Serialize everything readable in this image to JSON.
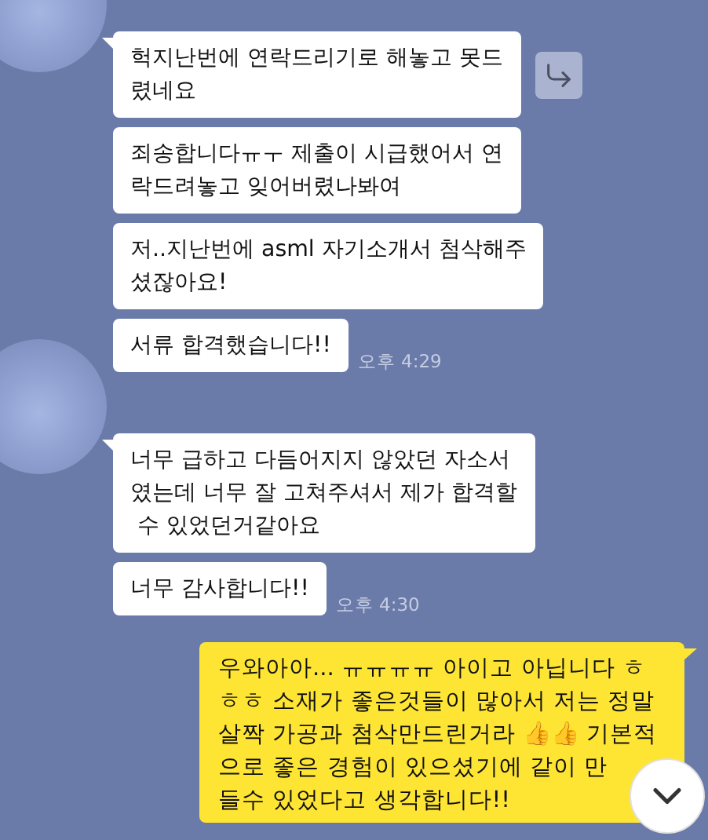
{
  "groups": [
    {
      "kind": "received",
      "time": "오후 4:29",
      "messages": [
        {
          "text": "헉지난번에 연락드리기로 해놓고 못드\n렸네요",
          "forward_button": true
        },
        {
          "text": "죄송합니다ㅠㅜ 제출이 시급했어서 연\n락드려놓고 잊어버렸나봐여"
        },
        {
          "text": "저..지난번에 asml 자기소개서 첨삭해주\n셨잖아요!"
        },
        {
          "text": "서류 합격했습니다!!"
        }
      ]
    },
    {
      "kind": "received",
      "time": "오후 4:30",
      "messages": [
        {
          "text": "너무 급하고 다듬어지지 않았던 자소서\n였는데 너무 잘 고쳐주셔서 제가 합격할\n 수 있었던거같아요"
        },
        {
          "text": "너무 감사합니다!!"
        }
      ]
    },
    {
      "kind": "sent",
      "messages": [
        {
          "text": "우와아아... ㅠㅠㅠㅠ 아이고 아닙니다 ㅎㅎㅎ 소재가 좋은것들이 많아서 저는 정말 살짝 가공과 첨삭만드린거라 👍👍 기본적으로 좋은 경험이 있으셨기에 같이 만들수 있었다고 생각합니다!!"
        }
      ]
    }
  ]
}
